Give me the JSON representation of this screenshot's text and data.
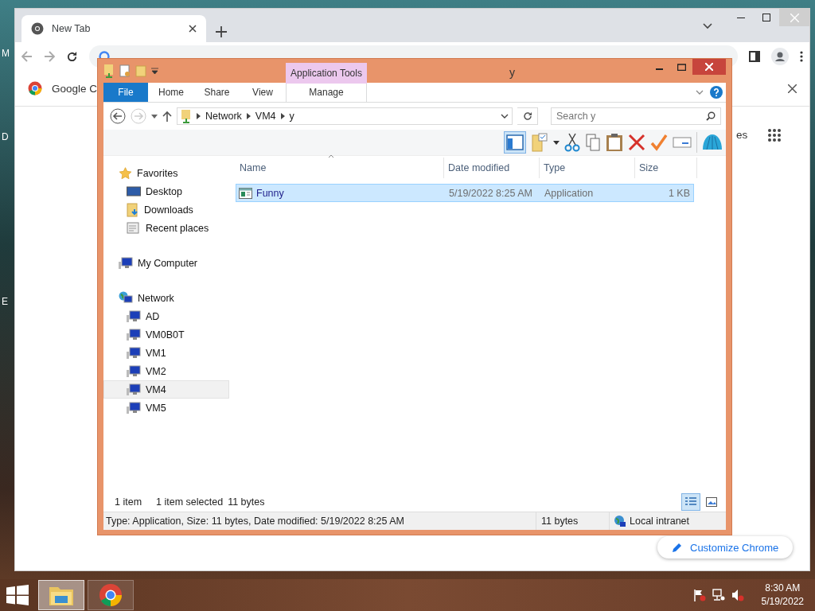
{
  "desktop": {
    "icon_labels": [
      "M",
      "D",
      "E"
    ]
  },
  "browser": {
    "tabs": [
      {
        "label": "New Tab",
        "selected": true
      }
    ],
    "bookmarks": [
      {
        "label": "Google C"
      }
    ],
    "page": {
      "link": "es",
      "customize_button": "Customize Chrome"
    }
  },
  "explorer": {
    "title": "y",
    "context_tab": "Application Tools",
    "ribbon_tabs": [
      {
        "label": "File",
        "kind": "file"
      },
      {
        "label": "Home",
        "kind": "tab"
      },
      {
        "label": "Share",
        "kind": "tab"
      },
      {
        "label": "View",
        "kind": "tab"
      },
      {
        "label": "Manage",
        "kind": "context"
      }
    ],
    "breadcrumb": [
      "Network",
      "VM4",
      "y"
    ],
    "search": {
      "placeholder": "Search y"
    },
    "nav": [
      {
        "label": "Favorites",
        "kind": "star",
        "selected": false,
        "children": [
          {
            "label": "Desktop",
            "kind": "desktop",
            "selected": false
          },
          {
            "label": "Downloads",
            "kind": "downloads",
            "selected": false
          },
          {
            "label": "Recent places",
            "kind": "recent",
            "selected": false
          }
        ]
      },
      {
        "label": "My Computer",
        "kind": "computer",
        "selected": false
      },
      {
        "label": "Network",
        "kind": "network",
        "selected": false,
        "children": [
          {
            "label": "AD",
            "kind": "computer",
            "selected": false
          },
          {
            "label": "VM0B0T",
            "kind": "computer",
            "selected": false
          },
          {
            "label": "VM1",
            "kind": "computer",
            "selected": false
          },
          {
            "label": "VM2",
            "kind": "computer",
            "selected": false
          },
          {
            "label": "VM4",
            "kind": "computer",
            "selected": true
          },
          {
            "label": "VM5",
            "kind": "computer",
            "selected": false
          }
        ]
      }
    ],
    "columns": [
      "Name",
      "Date modified",
      "Type",
      "Size"
    ],
    "files": [
      {
        "name": "Funny",
        "date_modified": "5/19/2022 8:25 AM",
        "type": "Application",
        "size": "1 KB",
        "selected": true
      }
    ],
    "status": {
      "count": "1 item",
      "selection": "1 item selected",
      "selection_size": "11 bytes"
    },
    "view_modes": [
      {
        "kind": "details",
        "selected": true
      },
      {
        "kind": "thumbnails",
        "selected": false
      }
    ],
    "details_bar": {
      "summary": "Type: Application, Size: 11 bytes, Date modified: 5/19/2022 8:25 AM",
      "size": "11 bytes",
      "zone": "Local intranet"
    }
  },
  "taskbar": {
    "apps": [
      {
        "kind": "explorer",
        "selected": true
      },
      {
        "kind": "chrome",
        "selected": false
      }
    ],
    "time": "8:30 AM",
    "date": "5/19/2022"
  }
}
